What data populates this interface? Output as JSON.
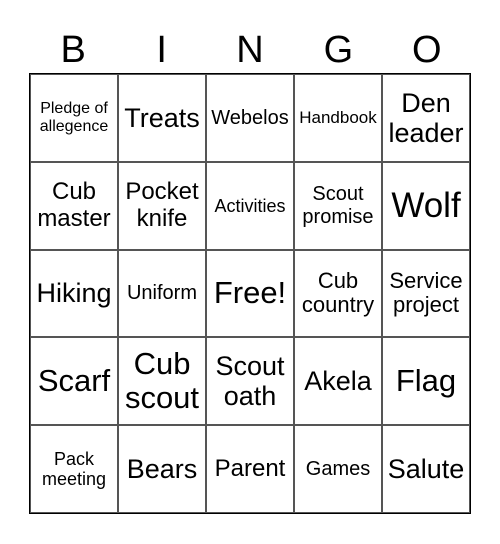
{
  "header": [
    "B",
    "I",
    "N",
    "G",
    "O"
  ],
  "cells": [
    [
      "Pledge of allegence",
      "Treats",
      "Webelos",
      "Handbook",
      "Den leader"
    ],
    [
      "Cub master",
      "Pocket knife",
      "Activities",
      "Scout promise",
      "Wolf"
    ],
    [
      "Hiking",
      "Uniform",
      "Free!",
      "Cub country",
      "Service project"
    ],
    [
      "Scarf",
      "Cub scout",
      "Scout oath",
      "Akela",
      "Flag"
    ],
    [
      "Pack meeting",
      "Bears",
      "Parent",
      "Games",
      "Salute"
    ]
  ]
}
